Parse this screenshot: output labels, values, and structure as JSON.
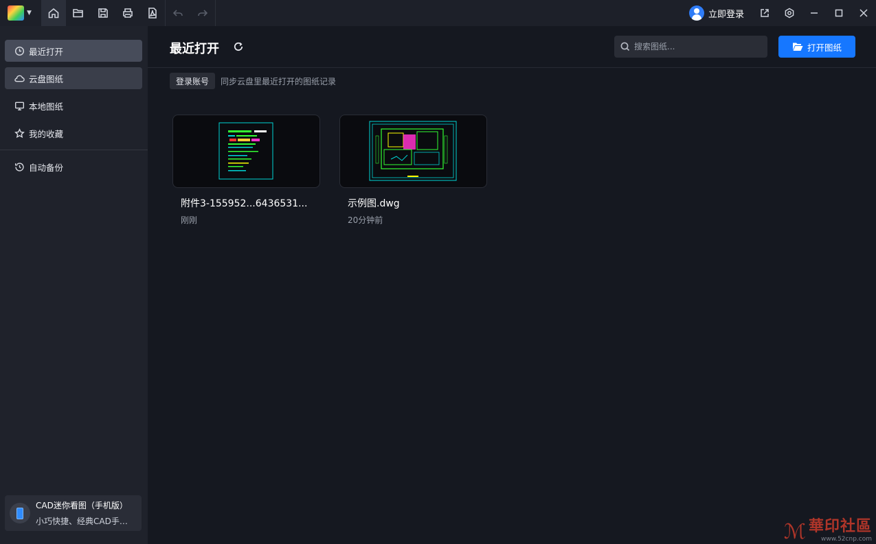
{
  "titlebar": {
    "toolbar_icons": [
      "home-icon",
      "open-folder-icon",
      "save-icon",
      "print-icon",
      "pdf-icon",
      "undo-icon",
      "redo-icon"
    ],
    "login_label": "立即登录",
    "window_icons": [
      "share-icon",
      "settings-icon",
      "minimize-icon",
      "maximize-icon",
      "close-icon"
    ]
  },
  "sidebar": {
    "items": [
      {
        "label": "最近打开",
        "icon": "clock-icon"
      },
      {
        "label": "云盘图纸",
        "icon": "cloud-icon"
      },
      {
        "label": "本地图纸",
        "icon": "monitor-icon"
      },
      {
        "label": "我的收藏",
        "icon": "star-icon"
      },
      {
        "label": "自动备份",
        "icon": "history-icon"
      }
    ],
    "promo": {
      "title": "CAD迷你看图（手机版）",
      "subtitle": "小巧快捷、经典CAD手机看图"
    }
  },
  "main": {
    "title": "最近打开",
    "search_placeholder": "搜索图纸...",
    "open_button_label": "打开图纸",
    "login_chip": "登录账号",
    "login_hint": "同步云盘里最近打开的图纸记录",
    "files": [
      {
        "name": "附件3-155952...6436531...",
        "time": "刚刚"
      },
      {
        "name": "示例图.dwg",
        "time": "20分钟前"
      }
    ]
  },
  "watermark": {
    "text": "華印社區",
    "url": "www.52cnp.com"
  },
  "colors": {
    "accent": "#1677ff",
    "background": "#151820",
    "sidebar": "#1f222b",
    "cad_cyan": "#00d5d5",
    "cad_green": "#33ff33",
    "cad_magenta": "#ff33cc",
    "cad_yellow": "#ffff00"
  }
}
